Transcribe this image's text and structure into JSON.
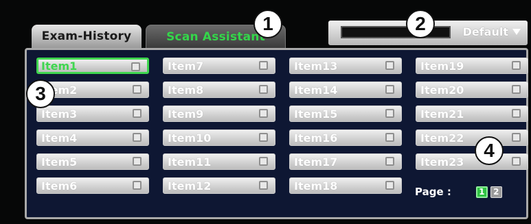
{
  "tabs": [
    {
      "label": "Exam-History",
      "active": false
    },
    {
      "label": "Scan Assistant",
      "active": true
    }
  ],
  "preset": {
    "value": "Default"
  },
  "items": [
    {
      "label": "Item1",
      "selected": true
    },
    {
      "label": "Item7"
    },
    {
      "label": "Item13"
    },
    {
      "label": "Item19"
    },
    {
      "label": "Item2"
    },
    {
      "label": "Item8"
    },
    {
      "label": "Item14"
    },
    {
      "label": "Item20"
    },
    {
      "label": "Item3"
    },
    {
      "label": "Item9"
    },
    {
      "label": "Item15"
    },
    {
      "label": "Item21"
    },
    {
      "label": "Item4"
    },
    {
      "label": "Item10"
    },
    {
      "label": "Item16"
    },
    {
      "label": "Item22"
    },
    {
      "label": "Item5"
    },
    {
      "label": "Item11"
    },
    {
      "label": "Item17"
    },
    {
      "label": "Item23"
    },
    {
      "label": "Item6"
    },
    {
      "label": "Item12"
    },
    {
      "label": "Item18"
    }
  ],
  "pagination": {
    "label": "Page :",
    "pages": [
      "1",
      "2"
    ],
    "current": "1"
  },
  "callouts": [
    "1",
    "2",
    "3",
    "4"
  ],
  "colors": {
    "accent": "#3fd64f",
    "panel": "#0e1733",
    "background": "#060707"
  }
}
